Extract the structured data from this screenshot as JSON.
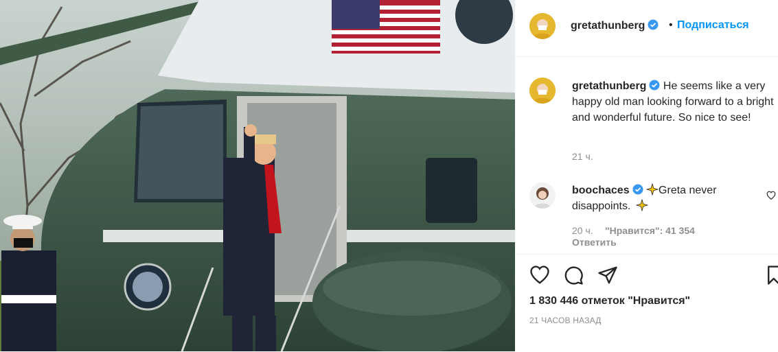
{
  "header": {
    "username": "gretathunberg",
    "separator": "•",
    "follow_label": "Подписаться"
  },
  "caption": {
    "username": "gretathunberg",
    "text": "He seems like a very happy old man looking forward to a bright and wonderful future. So nice to see!",
    "time": "21 ч."
  },
  "comment": {
    "username": "boochaces",
    "text": "Greta never disappoints.",
    "time": "20 ч.",
    "likes": "\"Нравится\": 41 354",
    "reply_label": "Ответить"
  },
  "likes_text": "1 830 446 отметок \"Нравится\"",
  "posted_ago": "21 ЧАСОВ НАЗАД",
  "colors": {
    "link_blue": "#0095f6",
    "verified_blue": "#3897f0",
    "text": "#262626",
    "muted": "#8e8e8e"
  },
  "icons": [
    "verified-badge-icon",
    "heart-icon",
    "comment-icon",
    "share-icon",
    "bookmark-icon",
    "sparkle-icon"
  ]
}
